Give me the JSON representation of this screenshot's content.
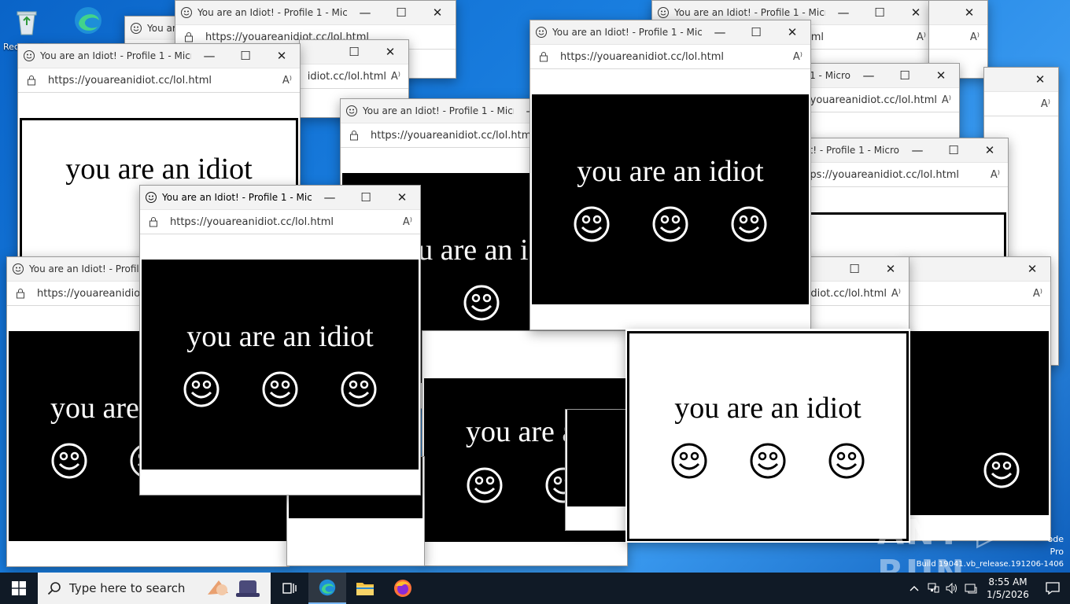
{
  "desktop": {
    "icons": [
      {
        "name": "recycle-bin",
        "label": "Recycle Bin"
      },
      {
        "name": "edge",
        "label": ""
      }
    ],
    "build_text": [
      "ode",
      "Pro",
      "Build 19041.vb_release.191206-1406"
    ],
    "watermark": "ANY ▷ RUN"
  },
  "window_common": {
    "title": "You are an Idiot! - Profile 1 - Micro...",
    "url": "https://youareanidiot.cc/lol.html",
    "minimize": "—",
    "maximize": "☐",
    "close": "✕",
    "read_aloud": "A⁾",
    "message": "you are an idiot"
  },
  "windows": [
    {
      "id": "w1",
      "variant": "black"
    },
    {
      "id": "w2",
      "variant": "black"
    },
    {
      "id": "w3",
      "variant": "white"
    },
    {
      "id": "w4",
      "variant": "black"
    },
    {
      "id": "w5",
      "variant": "white"
    },
    {
      "id": "w6",
      "variant": "black"
    },
    {
      "id": "w7",
      "variant": "black"
    },
    {
      "id": "w8",
      "variant": "white"
    },
    {
      "id": "w9",
      "variant": "black"
    },
    {
      "id": "w10",
      "variant": "white"
    }
  ],
  "taskbar": {
    "search_placeholder": "Type here to search",
    "time": "8:55 AM",
    "date": "1/5/2026",
    "apps": [
      "task-view",
      "edge",
      "file-explorer",
      "firefox"
    ]
  }
}
